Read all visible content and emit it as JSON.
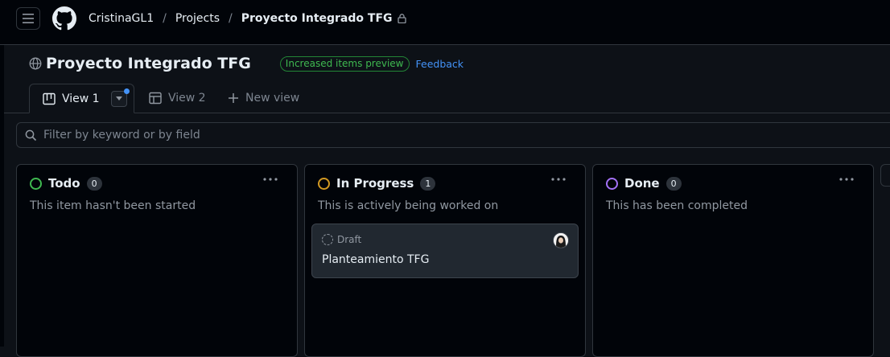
{
  "breadcrumb": {
    "owner": "CristinaGL1",
    "separator": "/",
    "section": "Projects",
    "project": "Proyecto Integrado TFG"
  },
  "header": {
    "title": "Proyecto Integrado TFG",
    "badge": "Increased items preview",
    "feedback_link": "Feedback"
  },
  "tabs": [
    {
      "label": "View 1",
      "icon": "board-icon",
      "active": true
    },
    {
      "label": "View 2",
      "icon": "table-icon",
      "active": false
    },
    {
      "label": "New view",
      "icon": "plus-icon",
      "active": false
    }
  ],
  "filter": {
    "placeholder": "Filter by keyword or by field"
  },
  "columns": [
    {
      "name": "Todo",
      "count": "0",
      "description": "This item hasn't been started",
      "color": "#3fb950"
    },
    {
      "name": "In Progress",
      "count": "1",
      "description": "This is actively being worked on",
      "color": "#d29922",
      "cards": [
        {
          "type": "Draft",
          "title": "Planteamiento TFG"
        }
      ]
    },
    {
      "name": "Done",
      "count": "0",
      "description": "This has been completed",
      "color": "#a371f7"
    }
  ],
  "colors": {
    "background": "#0d1117",
    "accent": "#4493f8",
    "border": "#30363d"
  }
}
